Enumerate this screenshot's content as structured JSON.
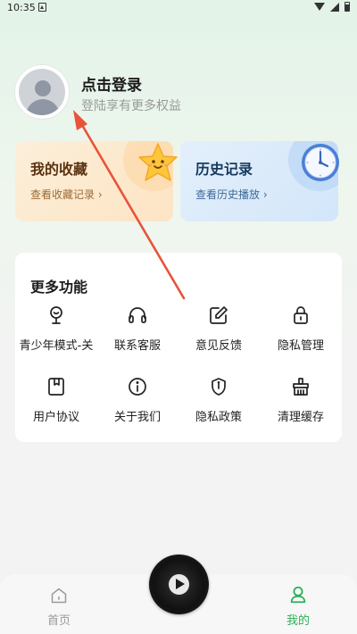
{
  "status_bar": {
    "time": "10:35"
  },
  "profile": {
    "title": "点击登录",
    "subtitle": "登陆享有更多权益"
  },
  "cards": {
    "favorites": {
      "title": "我的收藏",
      "link": "查看收藏记录 ›"
    },
    "history": {
      "title": "历史记录",
      "link": "查看历史播放 ›"
    }
  },
  "more": {
    "title": "更多功能",
    "items": [
      {
        "label": "青少年模式-关",
        "icon": "teen-mode-icon"
      },
      {
        "label": "联系客服",
        "icon": "headset-icon"
      },
      {
        "label": "意见反馈",
        "icon": "edit-icon"
      },
      {
        "label": "隐私管理",
        "icon": "lock-icon"
      },
      {
        "label": "用户协议",
        "icon": "book-icon"
      },
      {
        "label": "关于我们",
        "icon": "info-icon"
      },
      {
        "label": "隐私政策",
        "icon": "shield-icon"
      },
      {
        "label": "清理缓存",
        "icon": "broom-icon"
      }
    ]
  },
  "tabs": {
    "home": "首页",
    "mine": "我的"
  },
  "colors": {
    "accent": "#2ab15a",
    "annotation_arrow": "#e8533a"
  }
}
